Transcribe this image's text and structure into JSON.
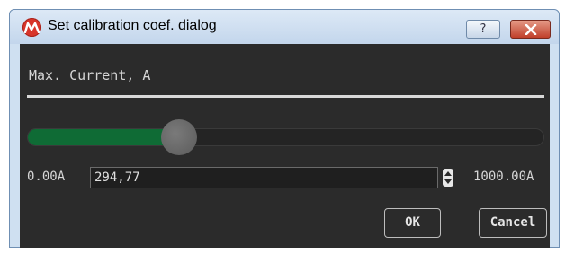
{
  "window": {
    "title": "Set calibration coef. dialog",
    "help_label": "?",
    "icons": {
      "app": "app-logo-icon",
      "close": "close-icon",
      "spin": "spin-up-down-icon"
    }
  },
  "section": {
    "title": "Max. Current, A"
  },
  "slider": {
    "min": 0.0,
    "max": 1000.0,
    "value": 294.77,
    "fill_color": "#0f6b35"
  },
  "range": {
    "min_label": "0.00A",
    "max_label": "1000.00A"
  },
  "value_field": {
    "value": "294,77"
  },
  "buttons": {
    "ok_label": "OK",
    "cancel_label": "Cancel"
  },
  "colors": {
    "content_bg": "#2b2b2b",
    "close_button": "#c0402b",
    "accent_green": "#0f6b35"
  }
}
